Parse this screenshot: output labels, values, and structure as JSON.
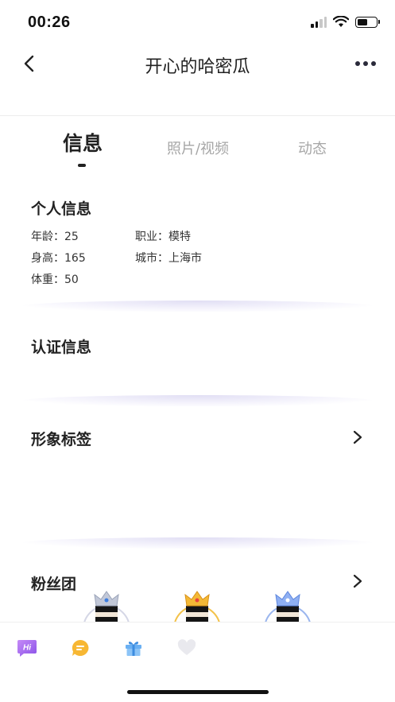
{
  "status_bar": {
    "time": "00:26"
  },
  "nav": {
    "title": "开心的哈密瓜",
    "back_icon": "chevron-left-icon",
    "more_icon": "more-dots-icon"
  },
  "tabs": [
    {
      "label": "信息",
      "active": true
    },
    {
      "label": "照片/视频",
      "active": false
    },
    {
      "label": "动态",
      "active": false
    }
  ],
  "personal_info": {
    "title": "个人信息",
    "age": "年龄：25",
    "height": "身高：165",
    "weight": "体重：50",
    "job": "职业：模特",
    "city": "城市：上海市"
  },
  "verification": {
    "title": "认证信息"
  },
  "image_tags": {
    "title": "形象标签"
  },
  "fan_club": {
    "title": "粉丝团",
    "crown_colors": [
      "#c0c6d6",
      "#f2b233",
      "#7ea3f0"
    ]
  },
  "bottom_bar": {
    "icons": [
      "hi-icon",
      "chat-icon",
      "gift-icon",
      "heart-icon"
    ],
    "hi_label": "Hi"
  },
  "colors": {
    "accent_purple": "#a66cf0",
    "accent_orange": "#f7b733",
    "accent_blue": "#6ab0f3"
  }
}
